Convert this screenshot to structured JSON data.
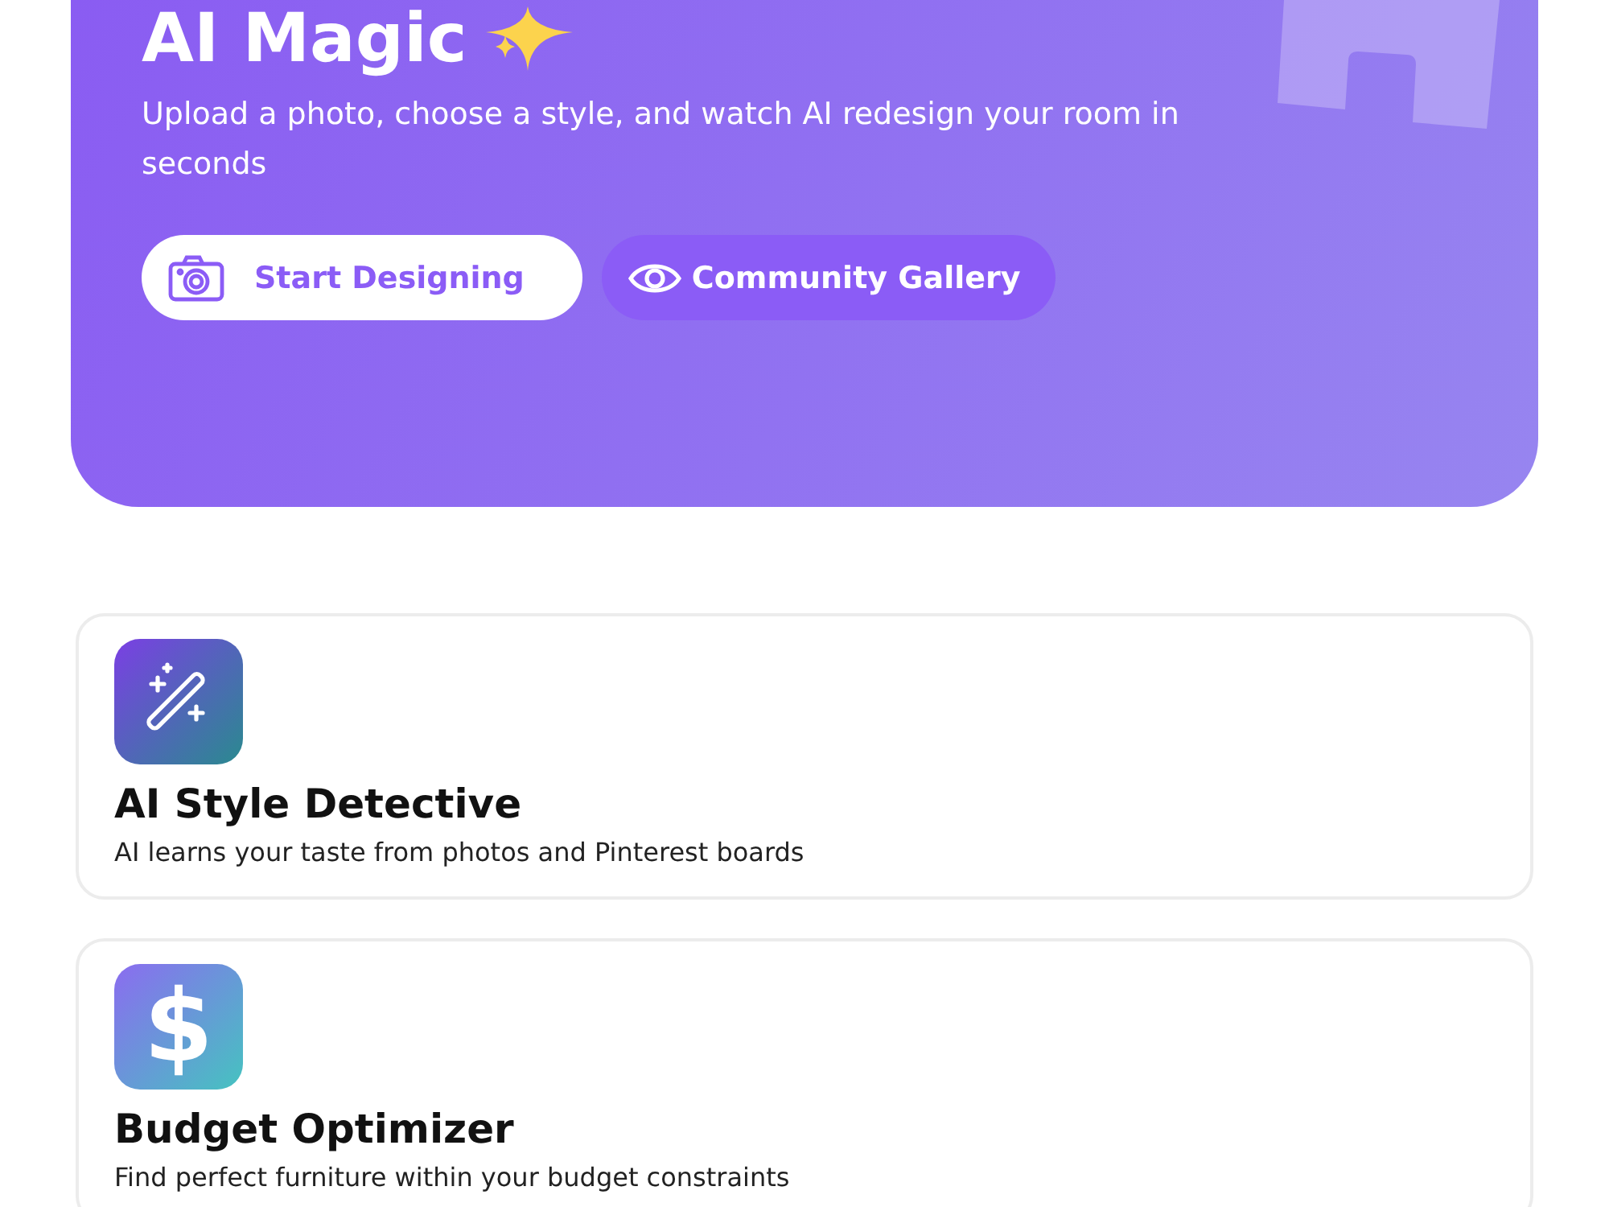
{
  "hero": {
    "title": "AI Magic",
    "subtitle": "Upload a photo, choose a style, and watch AI redesign your room in seconds",
    "buttons": [
      {
        "kind": "primary",
        "label": "Start Designing"
      },
      {
        "kind": "secondary",
        "label": "Community Gallery"
      }
    ]
  },
  "features": [
    {
      "kind": "wand",
      "title": "AI Style Detective",
      "description": "AI learns your taste from photos and Pinterest boards"
    },
    {
      "kind": "glyph",
      "glyph": "$",
      "title": "Budget Optimizer",
      "description": "Find perfect furniture within your budget constraints"
    }
  ]
}
